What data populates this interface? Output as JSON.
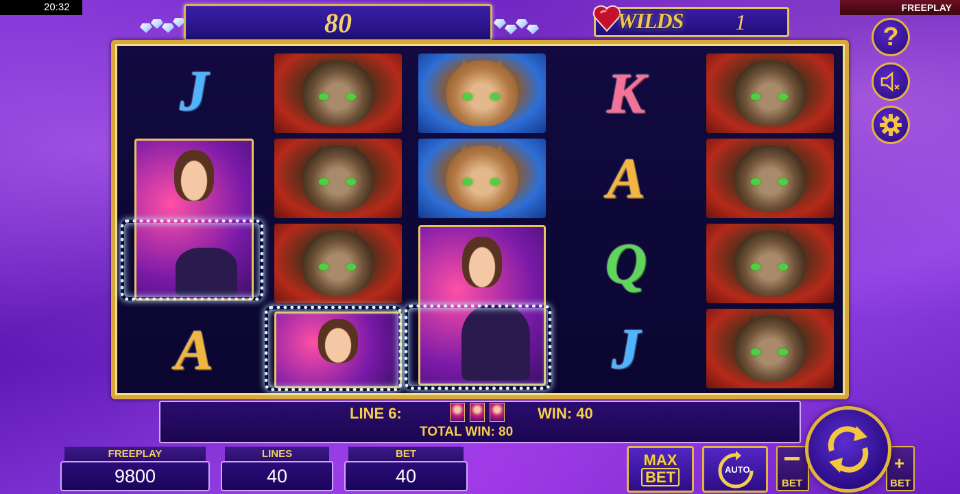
{
  "status_bar": {
    "time": "20:32",
    "mode": "FREEPLAY"
  },
  "header": {
    "win_amount": "80",
    "wilds_label": "WILDS",
    "wilds_count": "1"
  },
  "side_buttons": [
    {
      "name": "help",
      "icon": "question-icon"
    },
    {
      "name": "sound",
      "icon": "speaker-muted-icon"
    },
    {
      "name": "settings",
      "icon": "gear-icon"
    }
  ],
  "reels": [
    [
      "J",
      "woman-with-cat",
      "woman-with-cat",
      "A"
    ],
    [
      "cat-red",
      "cat-red",
      "cat-red",
      "woman-with-cat"
    ],
    [
      "cat-blue",
      "cat-blue",
      "woman-with-cat",
      "woman-with-cat"
    ],
    [
      "K",
      "A",
      "Q",
      "J"
    ],
    [
      "cat-red",
      "cat-red",
      "cat-red",
      "cat-red"
    ]
  ],
  "win_info": {
    "line_label": "LINE 6:",
    "line_win_label": "WIN: 40",
    "total_win_label": "TOTAL WIN: 80",
    "symbol_count": 3
  },
  "meters": {
    "freeplay": {
      "label": "FREEPLAY",
      "value": "9800"
    },
    "lines": {
      "label": "LINES",
      "value": "40"
    },
    "bet": {
      "label": "BET",
      "value": "40"
    }
  },
  "controls": {
    "max_bet_line1": "MAX",
    "max_bet_line2": "BET",
    "auto_label": "AUTO",
    "bet_minus_label": "BET",
    "bet_plus_label": "BET"
  },
  "colors": {
    "accent_gold": "#e3b53b",
    "panel_purple": "#2a0d6e",
    "text_gold": "#f6cf4a"
  }
}
